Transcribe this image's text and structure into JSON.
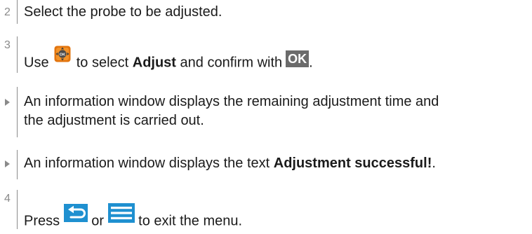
{
  "steps": [
    {
      "marker": "2",
      "text": "Select the probe to be adjusted."
    },
    {
      "marker": "3",
      "t1": "Use",
      "t2": "to select",
      "t3": "Adjust",
      "t4": "and confirm with",
      "ok": "OK",
      "t5": "."
    },
    {
      "line1": "An information window displays the remaining adjustment time and",
      "line2": "the adjustment is carried out."
    },
    {
      "t1": "An information window displays the text",
      "t2": "Adjustment successful!",
      "t3": "."
    },
    {
      "marker": "4",
      "t1": "Press",
      "t2": "or",
      "t3": "to exit the menu."
    }
  ],
  "icons": [
    "joystick-icon",
    "ok-key-icon",
    "back-key-icon",
    "menu-key-icon"
  ]
}
